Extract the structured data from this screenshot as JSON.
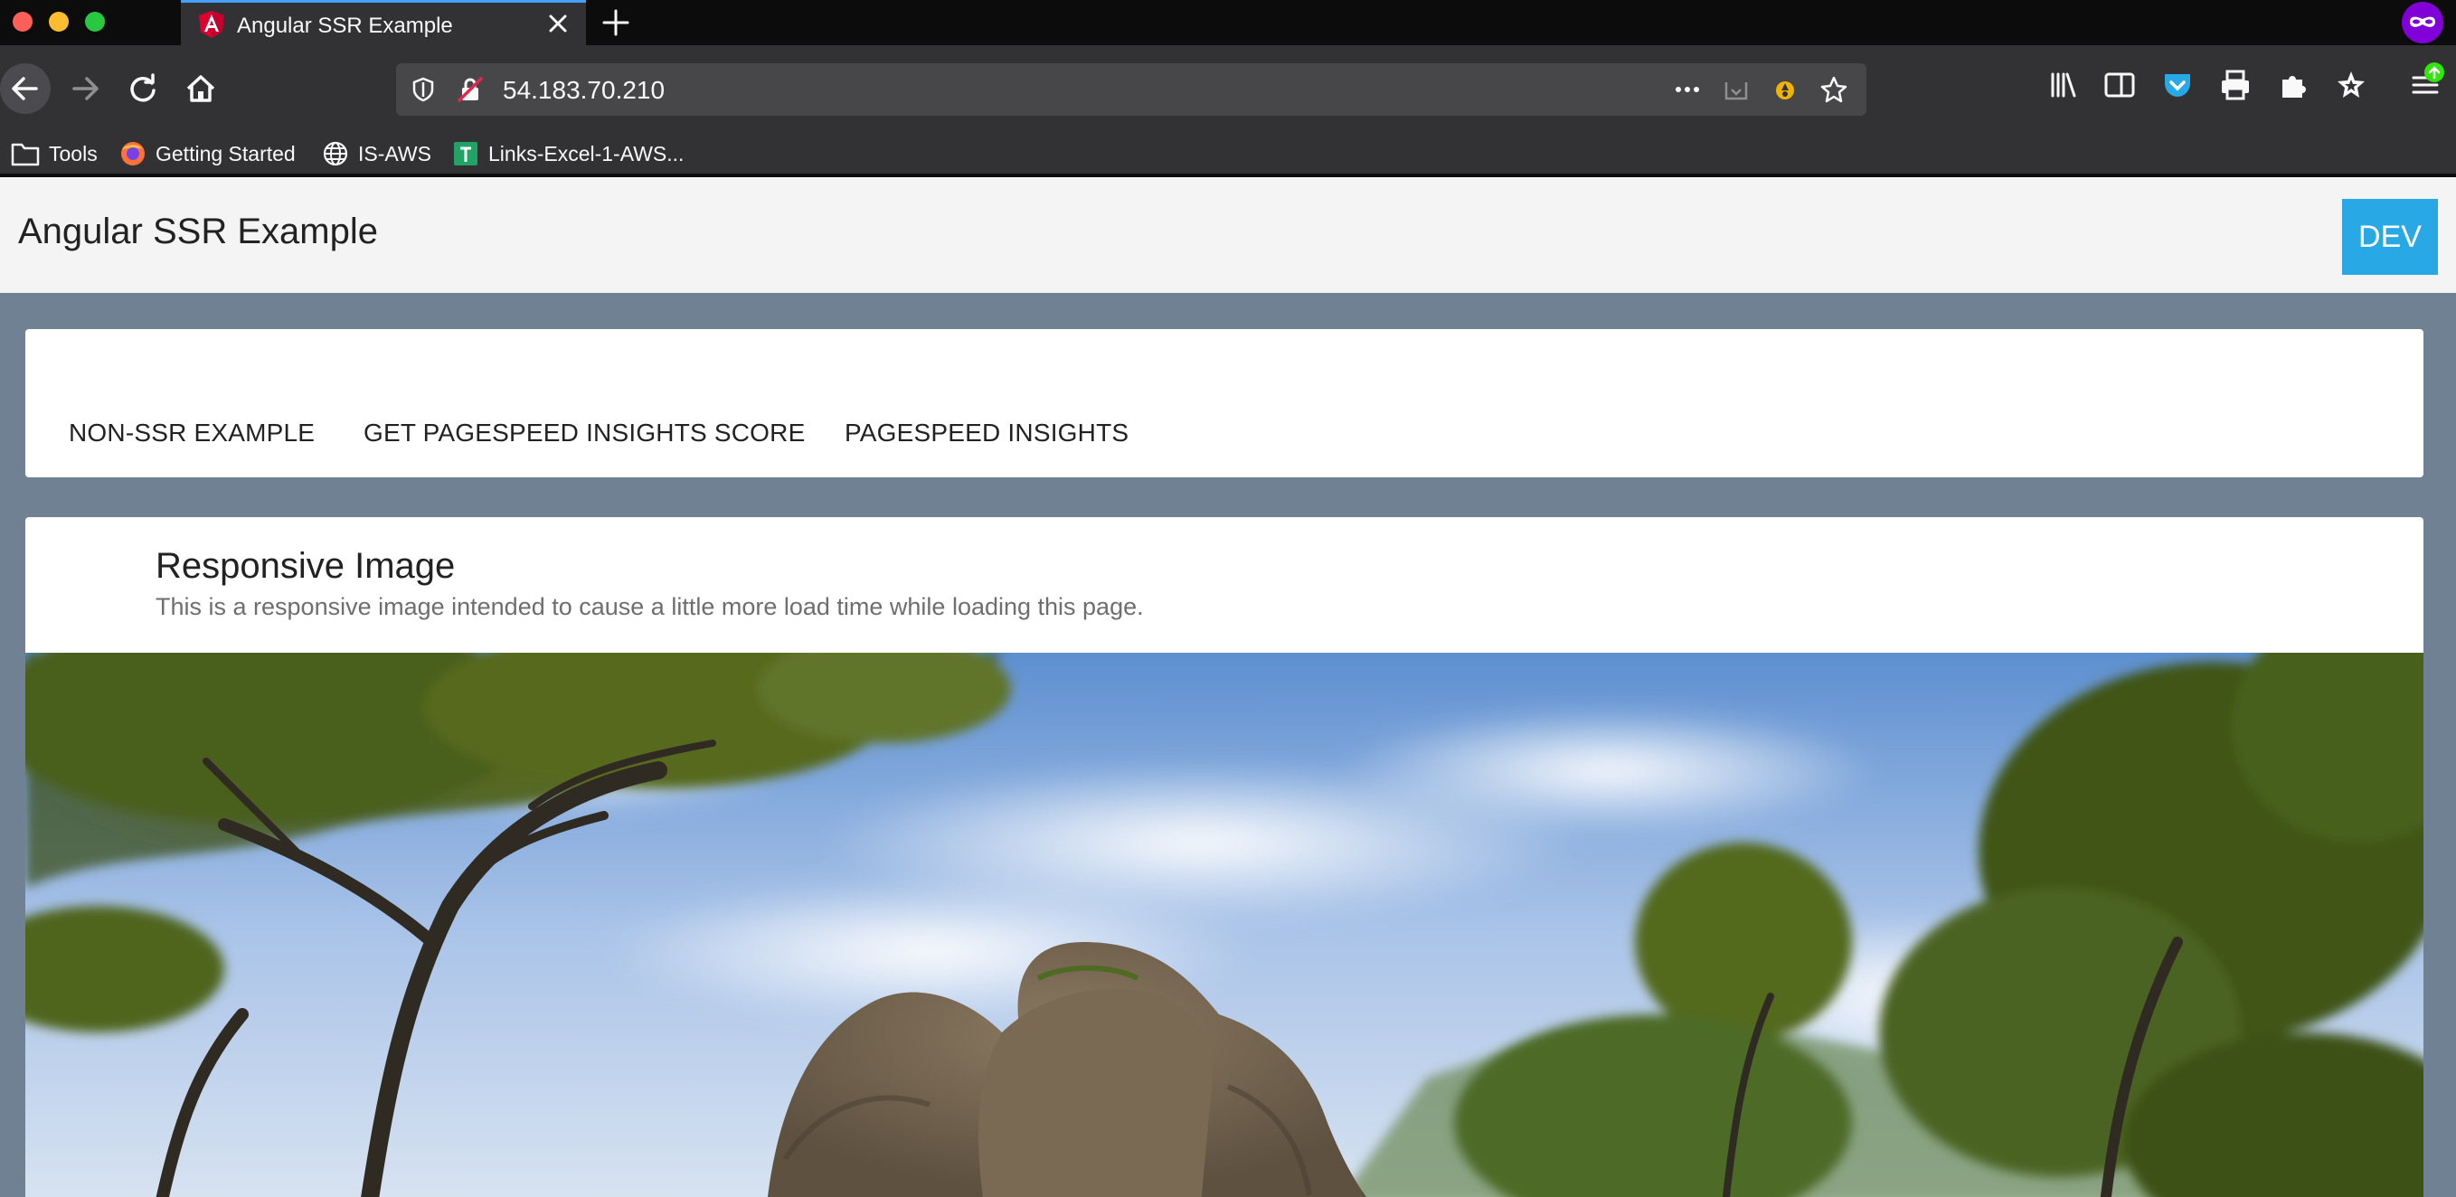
{
  "browser": {
    "tab": {
      "title": "Angular SSR Example"
    },
    "url": "54.183.70.210",
    "bookmarks": [
      {
        "label": "Tools",
        "icon": "folder-icon"
      },
      {
        "label": "Getting Started",
        "icon": "firefox-icon"
      },
      {
        "label": "IS-AWS",
        "icon": "globe-icon"
      },
      {
        "label": "Links-Excel-1-AWS...",
        "icon": "sheets-icon"
      }
    ]
  },
  "app": {
    "title": "Angular SSR Example",
    "env_button": "DEV",
    "nav_links": [
      "NON-SSR EXAMPLE",
      "GET PAGESPEED INSIGHTS SCORE",
      "PAGESPEED INSIGHTS"
    ],
    "image_card": {
      "title": "Responsive Image",
      "subtitle": "This is a responsive image intended to cause a little more load time while loading this page.",
      "image": "elephant-photo"
    }
  },
  "colors": {
    "page_bg": "#6f8192",
    "dev_button": "#29a8e6",
    "chrome_dark": "#0c0c0d",
    "toolbar": "#323234"
  }
}
